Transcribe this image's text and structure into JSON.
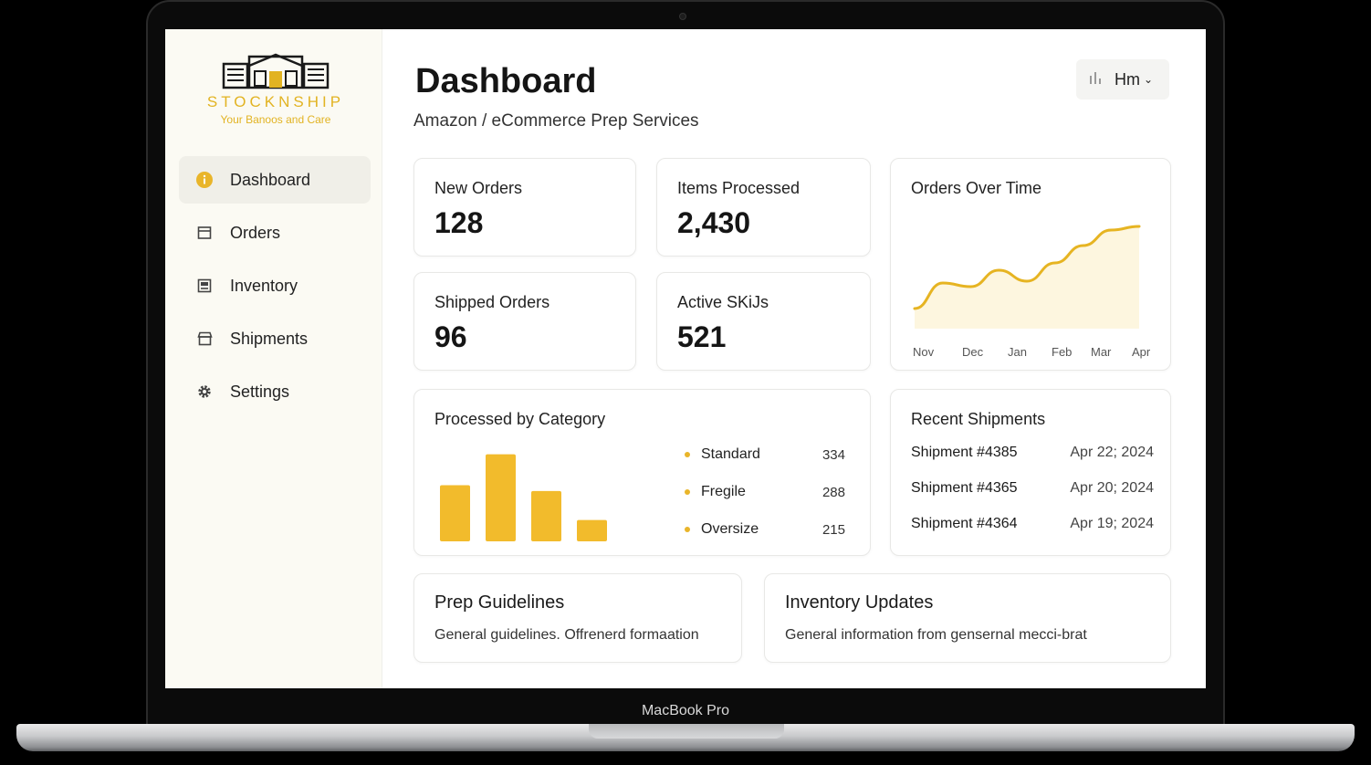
{
  "device_label": "MacBook Pro",
  "brand": {
    "name": "STOCKNSHIP",
    "tagline": "Your Banoos and Care",
    "accent": "#e2b322"
  },
  "nav": [
    {
      "label": "Dashboard",
      "icon": "info-circle-icon"
    },
    {
      "label": "Orders",
      "icon": "box-icon"
    },
    {
      "label": "Inventory",
      "icon": "inventory-icon"
    },
    {
      "label": "Shipments",
      "icon": "store-icon"
    },
    {
      "label": "Settings",
      "icon": "gear-icon"
    }
  ],
  "header": {
    "title": "Dashboard",
    "subtitle": "Amazon / eCommerce Prep Services",
    "user": "Hm"
  },
  "stats": [
    {
      "label": "New Orders",
      "value": "128"
    },
    {
      "label": "Items Processed",
      "value": "2,430"
    },
    {
      "label": "Shipped Orders",
      "value": "96"
    },
    {
      "label": "Active SKiJs",
      "value": "521"
    }
  ],
  "orders_chart": {
    "title": "Orders Over Time",
    "months": [
      "Nov",
      "Dec",
      "Jan",
      "Feb",
      "Mar",
      "Apr"
    ]
  },
  "category": {
    "title": "Processed by Category",
    "legend": [
      {
        "label": "Standard",
        "value": "334"
      },
      {
        "label": "Fregile",
        "value": "288"
      },
      {
        "label": "Oversize",
        "value": "215"
      }
    ]
  },
  "chart_data": [
    {
      "type": "line",
      "title": "Orders Over Time",
      "x": [
        "Nov",
        "Dec",
        "Jan",
        "Feb",
        "Mar",
        "Apr"
      ],
      "values": [
        10,
        38,
        34,
        52,
        40,
        60,
        79,
        96,
        100
      ],
      "ylim": [
        0,
        110
      ],
      "grid": false,
      "color": "#e6b422"
    },
    {
      "type": "bar",
      "title": "Processed by Category",
      "values": [
        58,
        90,
        52,
        22
      ],
      "ylim": [
        0,
        100
      ],
      "color": "#f2bb2c"
    }
  ],
  "shipments": {
    "title": "Recent Shipments",
    "rows": [
      {
        "id": "Shipment #4385",
        "date": "Apr 22; 2024"
      },
      {
        "id": "Shipment #4365",
        "date": "Apr 20; 2024"
      },
      {
        "id": "Shipment #4364",
        "date": "Apr 19; 2024"
      }
    ]
  },
  "guidelines": {
    "title": "Prep Guidelines",
    "text": "General guidelines. Offrenerd formaation"
  },
  "updates": {
    "title": "Inventory Updates",
    "text": "General information from gensernal mecci-brat"
  }
}
